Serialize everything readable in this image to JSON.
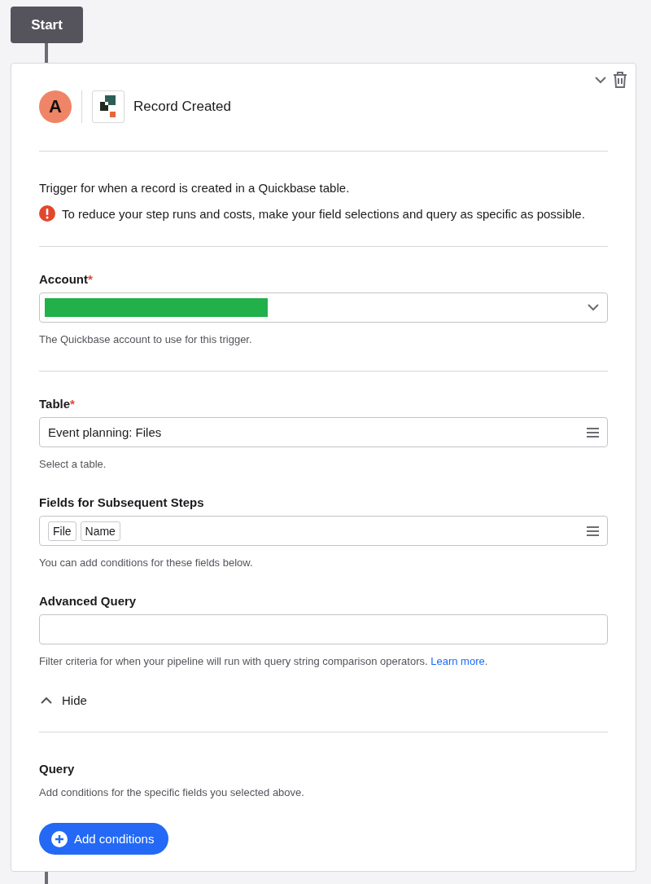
{
  "start_node": {
    "label": "Start"
  },
  "step": {
    "app_letter": "A",
    "title": "Record Created",
    "expanded": true,
    "description": "Trigger for when a record is created in a Quickbase table.",
    "warning": "To reduce your step runs and costs, make your field selections and query as specific as possible.",
    "fields": [
      {
        "kind": "select",
        "label": "Account",
        "required_mark": "*",
        "redacted": true,
        "help": "The Quickbase account to use for this trigger.",
        "divider_after": true
      },
      {
        "kind": "list",
        "label": "Table",
        "required_mark": "*",
        "value": "Event planning: Files",
        "help": "Select a table."
      },
      {
        "kind": "tags",
        "label": "Fields for Subsequent Steps",
        "tags": [
          "File",
          "Name"
        ],
        "help": "You can add conditions for these fields below."
      },
      {
        "kind": "text",
        "label": "Advanced Query",
        "help": "Filter criteria for when your pipeline will run with query string comparison operators.",
        "link": "Learn more",
        "link_suffix": "."
      }
    ],
    "toggle": {
      "label": "Hide",
      "expanded": true
    },
    "query": {
      "title": "Query",
      "help": "Add conditions for the specific fields you selected above.",
      "button": "Add conditions"
    }
  }
}
